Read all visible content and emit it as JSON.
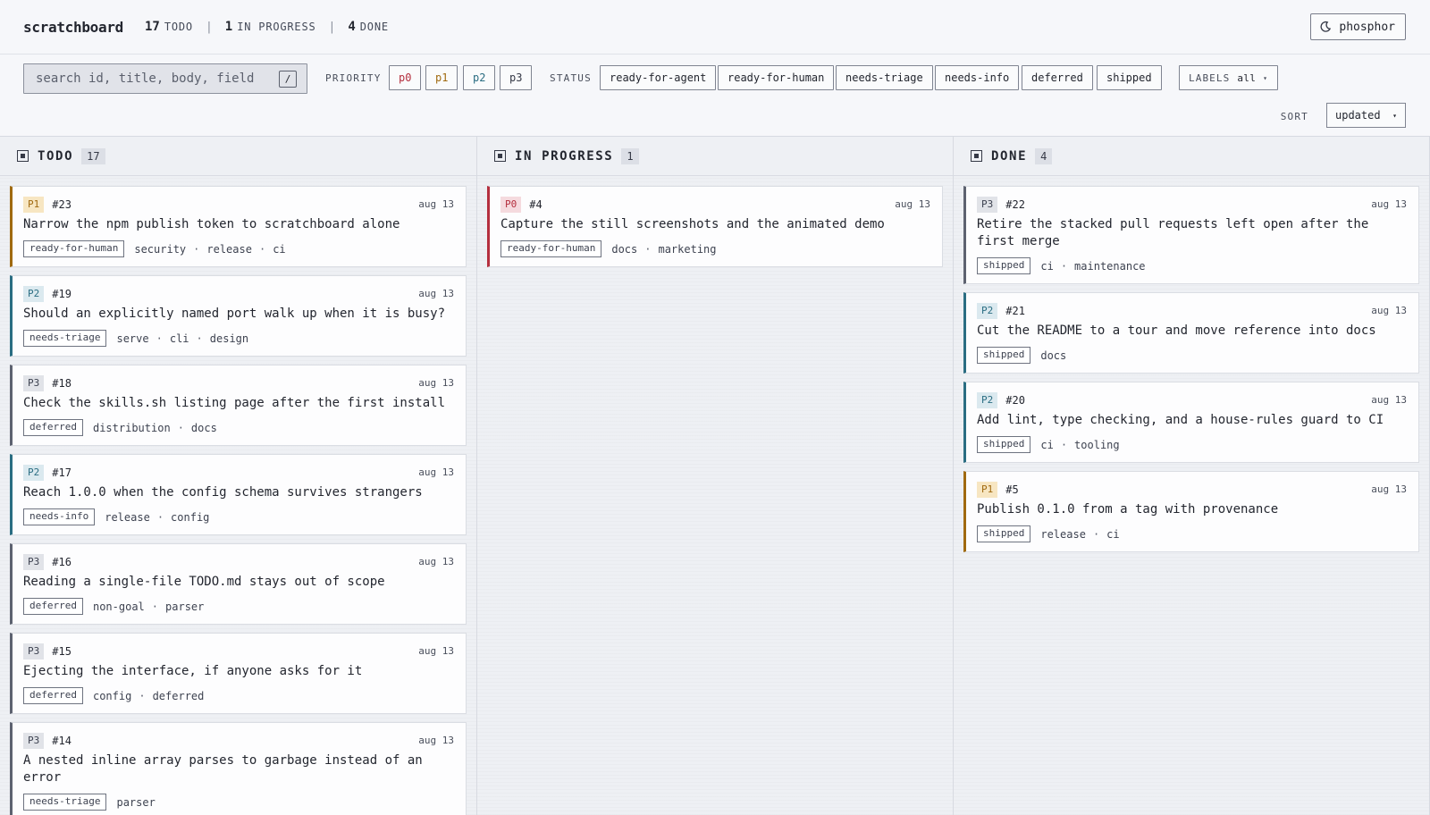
{
  "app": {
    "title": "scratchboard",
    "counts": [
      {
        "value": "17",
        "label": "TODO"
      },
      {
        "value": "1",
        "label": "IN PROGRESS"
      },
      {
        "value": "4",
        "label": "DONE"
      }
    ],
    "theme_button": {
      "label": "phosphor",
      "icon": "moon-icon"
    }
  },
  "filters": {
    "search": {
      "placeholder": "search id, title, body, field",
      "shortcut": "/"
    },
    "priority_label": "PRIORITY",
    "priorities": [
      "p0",
      "p1",
      "p2",
      "p3"
    ],
    "status_label": "STATUS",
    "statuses": [
      "ready-for-agent",
      "ready-for-human",
      "needs-triage",
      "needs-info",
      "deferred",
      "shipped"
    ],
    "labels_label": "LABELS",
    "labels_value": "all",
    "sort_label": "SORT",
    "sort_value": "updated"
  },
  "columns": [
    {
      "title": "TODO",
      "count": "17",
      "cards": [
        {
          "priority": "P1",
          "id": "#23",
          "date": "aug 13",
          "title": "Narrow the npm publish token to scratchboard alone",
          "status": "ready-for-human",
          "labels": [
            "security",
            "release",
            "ci"
          ]
        },
        {
          "priority": "P2",
          "id": "#19",
          "date": "aug 13",
          "title": "Should an explicitly named port walk up when it is busy?",
          "status": "needs-triage",
          "labels": [
            "serve",
            "cli",
            "design"
          ]
        },
        {
          "priority": "P3",
          "id": "#18",
          "date": "aug 13",
          "title": "Check the skills.sh listing page after the first install",
          "status": "deferred",
          "labels": [
            "distribution",
            "docs"
          ]
        },
        {
          "priority": "P2",
          "id": "#17",
          "date": "aug 13",
          "title": "Reach 1.0.0 when the config schema survives strangers",
          "status": "needs-info",
          "labels": [
            "release",
            "config"
          ]
        },
        {
          "priority": "P3",
          "id": "#16",
          "date": "aug 13",
          "title": "Reading a single-file TODO.md stays out of scope",
          "status": "deferred",
          "labels": [
            "non-goal",
            "parser"
          ]
        },
        {
          "priority": "P3",
          "id": "#15",
          "date": "aug 13",
          "title": "Ejecting the interface, if anyone asks for it",
          "status": "deferred",
          "labels": [
            "config",
            "deferred"
          ]
        },
        {
          "priority": "P3",
          "id": "#14",
          "date": "aug 13",
          "title": "A nested inline array parses to garbage instead of an error",
          "status": "needs-triage",
          "labels": [
            "parser"
          ]
        }
      ]
    },
    {
      "title": "IN PROGRESS",
      "count": "1",
      "cards": [
        {
          "priority": "P0",
          "id": "#4",
          "date": "aug 13",
          "title": "Capture the still screenshots and the animated demo",
          "status": "ready-for-human",
          "labels": [
            "docs",
            "marketing"
          ]
        }
      ]
    },
    {
      "title": "DONE",
      "count": "4",
      "cards": [
        {
          "priority": "P3",
          "id": "#22",
          "date": "aug 13",
          "title": "Retire the stacked pull requests left open after the first merge",
          "status": "shipped",
          "labels": [
            "ci",
            "maintenance"
          ]
        },
        {
          "priority": "P2",
          "id": "#21",
          "date": "aug 13",
          "title": "Cut the README to a tour and move reference into docs",
          "status": "shipped",
          "labels": [
            "docs"
          ]
        },
        {
          "priority": "P2",
          "id": "#20",
          "date": "aug 13",
          "title": "Add lint, type checking, and a house-rules guard to CI",
          "status": "shipped",
          "labels": [
            "ci",
            "tooling"
          ]
        },
        {
          "priority": "P1",
          "id": "#5",
          "date": "aug 13",
          "title": "Publish 0.1.0 from a tag with provenance",
          "status": "shipped",
          "labels": [
            "release",
            "ci"
          ]
        }
      ]
    }
  ]
}
